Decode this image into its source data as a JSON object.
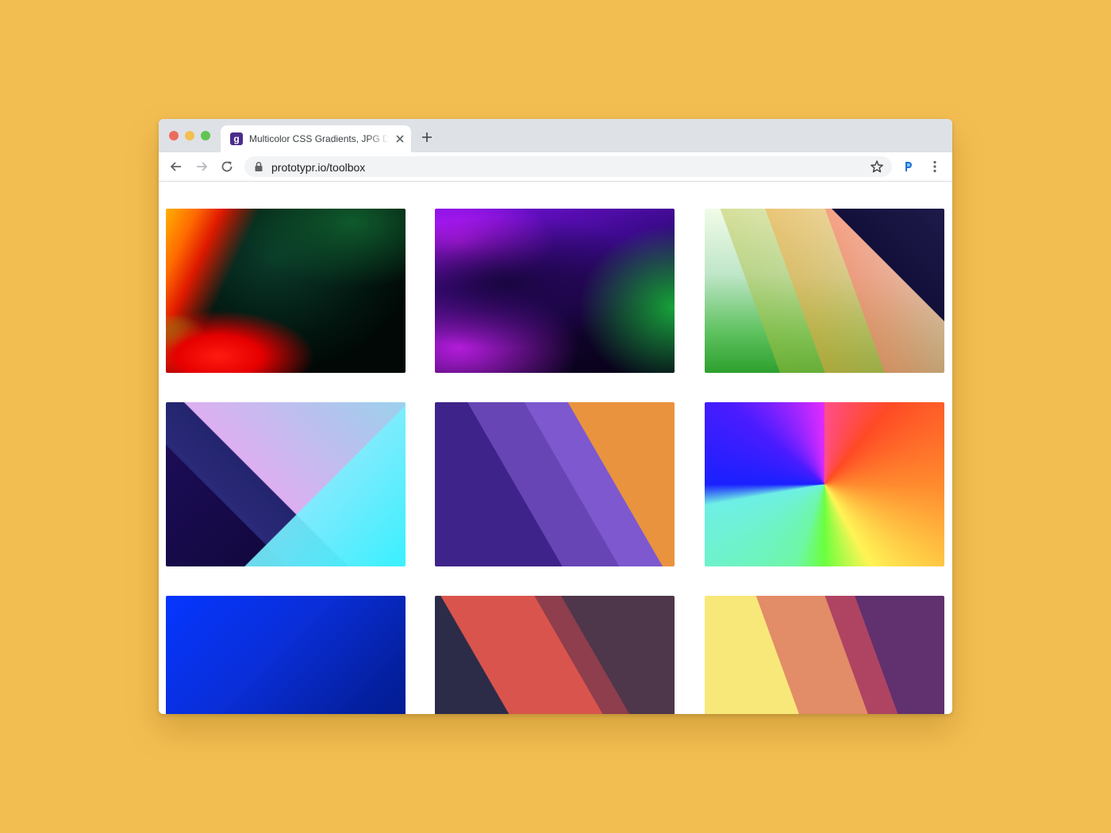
{
  "browser": {
    "tab": {
      "title": "Multicolor CSS Gradients, JPG Downloads",
      "favicon_glyph": "g"
    },
    "address_bar": {
      "url": "prototypr.io/toolbox"
    },
    "icons": {
      "back": "arrow-left-icon",
      "forward": "arrow-right-icon",
      "reload": "reload-icon",
      "lock": "lock-icon",
      "bookmark": "star-icon",
      "extension": "prototypr-extension-icon",
      "menu": "vertical-dots-icon",
      "close_tab": "close-icon",
      "new_tab": "plus-icon"
    }
  },
  "gallery": {
    "items": [
      {
        "name": "gradient-1",
        "colors": [
          "#FF6A00",
          "#E50000",
          "#02150F",
          "#0F5A2C"
        ]
      },
      {
        "name": "gradient-2",
        "colors": [
          "#C41CFF",
          "#3A0A8A",
          "#050214",
          "#17A33A"
        ]
      },
      {
        "name": "gradient-3",
        "colors": [
          "#F1FBE8",
          "#5FC260",
          "#FF7878",
          "#12103A"
        ]
      },
      {
        "name": "gradient-4",
        "colors": [
          "#1E0E5C",
          "#F0BEFF",
          "#3AF0FF",
          "#D64FA0"
        ]
      },
      {
        "name": "gradient-5",
        "colors": [
          "#3E238A",
          "#6745B4",
          "#7D58CF",
          "#E9933F"
        ]
      },
      {
        "name": "gradient-6",
        "colors": [
          "#1A20FF",
          "#E02CFF",
          "#FF4A25",
          "#FFF455",
          "#6BFF3E",
          "#6EEFE6"
        ]
      },
      {
        "name": "gradient-7",
        "colors": [
          "#0536FF",
          "#031A8A",
          "#FF1F6B"
        ]
      },
      {
        "name": "gradient-8",
        "colors": [
          "#2C2C48",
          "#D9544D",
          "#8E3E4C",
          "#4E364B"
        ]
      },
      {
        "name": "gradient-9",
        "colors": [
          "#F8E87A",
          "#E38C68",
          "#AE4462",
          "#60306F"
        ]
      }
    ]
  },
  "colors": {
    "page_background": "#F3BE51",
    "tabstrip": "#DEE1E6",
    "omnibox": "#F1F3F4"
  }
}
